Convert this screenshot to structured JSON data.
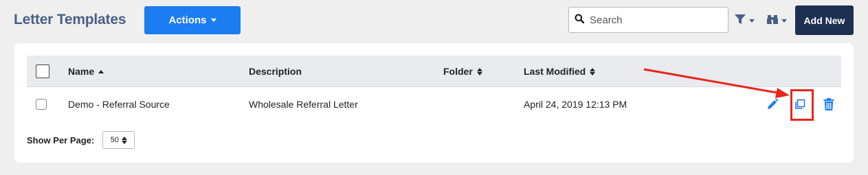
{
  "page": {
    "title": "Letter Templates"
  },
  "toolbar": {
    "actions_label": "Actions",
    "search_placeholder": "Search",
    "search_value": "",
    "add_new_label": "Add New",
    "filter_icon": "filter-icon",
    "binoculars_icon": "binoculars-icon"
  },
  "table": {
    "columns": [
      {
        "label": "Name",
        "sort": "asc"
      },
      {
        "label": "Description",
        "sort": "none"
      },
      {
        "label": "Folder",
        "sort": "both"
      },
      {
        "label": "Last Modified",
        "sort": "both"
      }
    ],
    "rows": [
      {
        "name": "Demo - Referral Source",
        "description": "Wholesale Referral Letter",
        "folder": "",
        "last_modified": "April 24, 2019 12:13 PM",
        "actions": [
          "edit-icon",
          "copy-icon",
          "trash-icon"
        ]
      }
    ]
  },
  "pagination": {
    "show_per_page_label": "Show Per Page:",
    "per_page_value": "50"
  },
  "colors": {
    "primary": "#1c7cf2",
    "title": "#4a5f86",
    "add_new_bg": "#1f2f52",
    "annotation": "#e8261b"
  }
}
